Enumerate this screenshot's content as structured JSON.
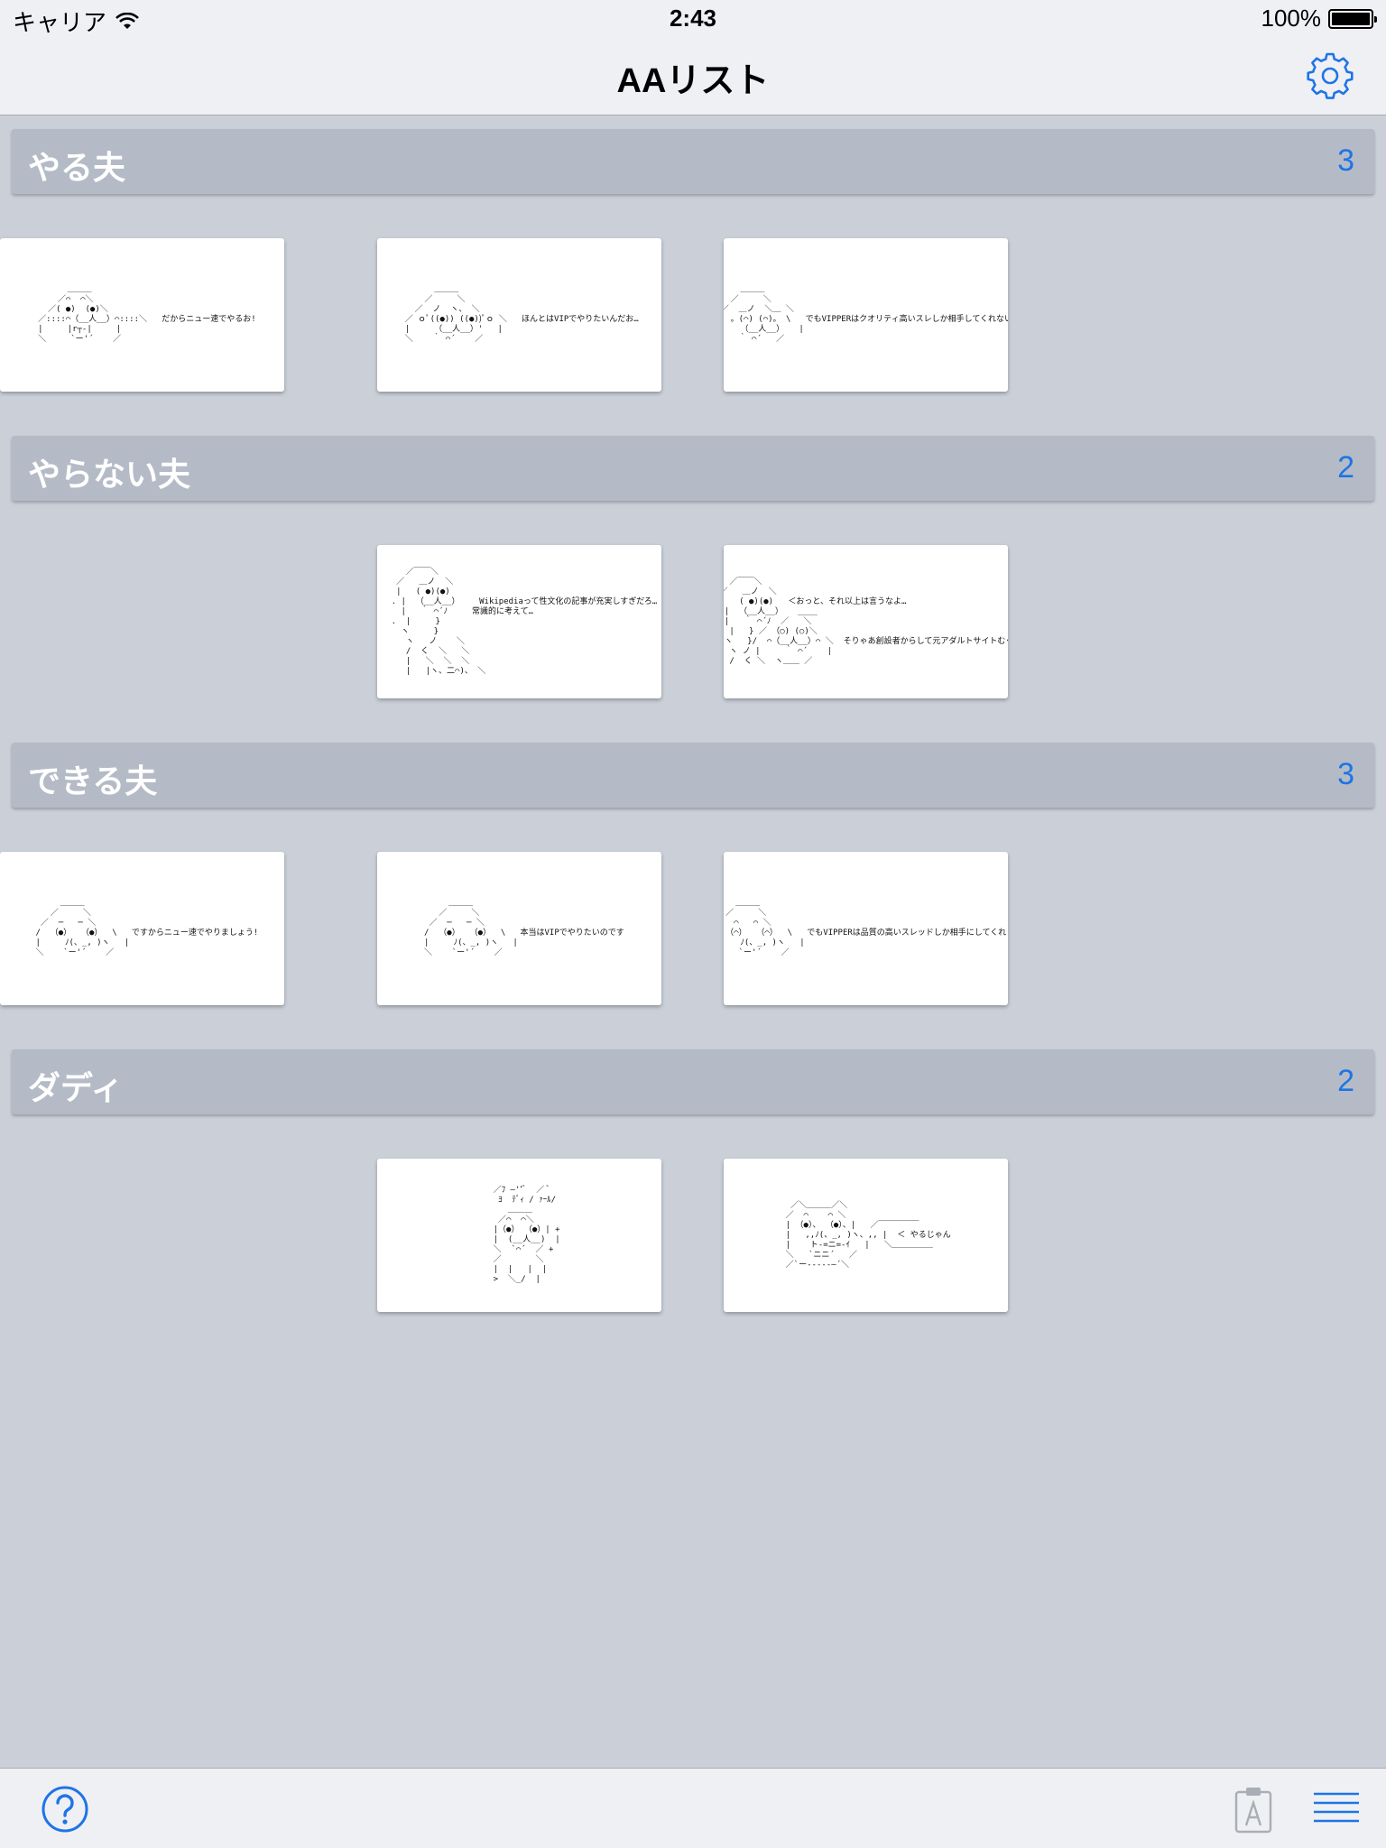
{
  "status_bar": {
    "carrier": "キャリア",
    "time": "2:43",
    "battery": "100%"
  },
  "nav": {
    "title": "AAリスト",
    "settings_icon": "gear-icon"
  },
  "sections": [
    {
      "title": "やる夫",
      "count": "3",
      "items": [
        {
          "aa": "       ＿＿＿\n     ／     ＼\n   ／  ノ  ヽ、 ＼\n ／ ｏﾟ((●)) ((●))ﾟｏ ＼   ほんとはVIPでやりたいんだお…\n |     （__人__）'   |\n ＼    ｀ ⌒´    ／"
        },
        {
          "aa": "       ＿＿＿\n     ／     ＼\n   ／  ＿ノ  ＼＿ ＼\n  /  。(⌒) (⌒)。 \\   でもVIPPERはクオリティ高いスレしか相手してくれないお…\n  |    （__人__）   |\n  ＼   ｀ ⌒´   ／"
        },
        {
          "aa": "        ＿＿＿\n      ／⌒  ⌒＼\n    ／( ●)  (●)＼\n  ／::::⌒（__人__）⌒::::＼   だからニュー速でやるお!\n  |     |r┬-|     |\n  ＼     `ー'´    ／"
        }
      ]
    },
    {
      "title": "やらない夫",
      "count": "2",
      "items": [
        {
          "aa": "     ／￣￣＼\n   ／   ＿ノ  ＼\n   |   ( ●)(●)\n  . |  （__人__）    Wikipediaって性文化の記事が充実しすぎだろ…\n    |   ｀ ⌒´ﾉ     常識的に考えて…\n  .  |     }\n    ヽ     }\n     ヽ   ノ    ＼\n     /  く  ＼   ＼\n     |   ＼  ＼  ＼\n     |   |ヽ、二⌒)、 ＼"
        },
        {
          "aa": "     ／￣￣＼\n   ／   ＿ノ  ＼\n   |   ( ●)(●)   ＜おっと、それ以上は言うなよ…\n  . |  （__人__）   ____\n    |   ｀ ⌒´ﾉ  ／   ＼\n  .  |   } ／ （○) (○)＼\n    ヽ   }/  ⌒（__人__）⌒ ＼  そりゃあ創設者からして元アダルトサイトむぐっ…\n     ヽ ノ |     ｀ ⌒´    |\n     /  く ＼  ヽ＿＿ ／"
        }
      ]
    },
    {
      "title": "できる夫",
      "count": "3",
      "items": [
        {
          "aa": "       ＿＿＿\n     ／     ＼\n   ／  ─   ─ ＼\n  /  （●）  （●）  \\   本当はVIPでやりたいのです\n  |     ﾉ(、_, )ヽ   |\n  ＼    `ー'´    ／"
        },
        {
          "aa": "       ＿＿＿\n     ／     ＼\n   ／  ⌒   ⌒ ＼\n  /  （⌒）  （⌒）  \\   でもVIPPERは品質の高いスレッドしか相手にしてくれません\n  |     ﾉ(、_, )ヽ   |\n  ＼    `ー'´    ／"
        },
        {
          "aa": "       ＿＿＿\n     ／     ＼\n   ／  ─   ─ ＼\n  /  （●）  （●）  \\   ですからニュー速でやりましょう!\n  |     ﾉ(、_, )ヽ   |\n  ＼    `ー'´    ／"
        }
      ]
    },
    {
      "title": "ダディ",
      "count": "2",
      "items": [
        {
          "aa": "   ／ﾌ ―''ﾞ  ／ ﾞ\n    ﾖ  ﾃﾞｨ / ｧｰﾙ/\n      ＿＿＿\n    ／⌒  ⌒＼\n   |（●） （●）| +\n   |  (__人__)  |\n   ＼  `⌒´  ／ +\n   ／       ＼\n   |  |   |  |\n   >  ＼_/  |"
        },
        {
          "aa": "  ／＼＿＿＿／＼\n ／  ⌒    ⌒ ＼\n | （●）、 （●）、|   ／￣￣￣￣￣\n |   ,,ﾉ(、_, )ヽ、,, |  ＜ やるじゃん\n |    ト-=ニ=-ｲ   |   ＼＿＿＿＿＿\n ＼   `ニニ´   ／\n ／`ー‐--‐‐―´＼"
        }
      ]
    }
  ],
  "toolbar": {
    "help_icon": "help-icon",
    "clipboard_icon": "clipboard-icon",
    "list_icon": "list-icon"
  },
  "colors": {
    "background": "#cbd0d8",
    "section_header": "#b4bbc6",
    "accent": "#1e74e6",
    "bar": "#eff0f4"
  }
}
